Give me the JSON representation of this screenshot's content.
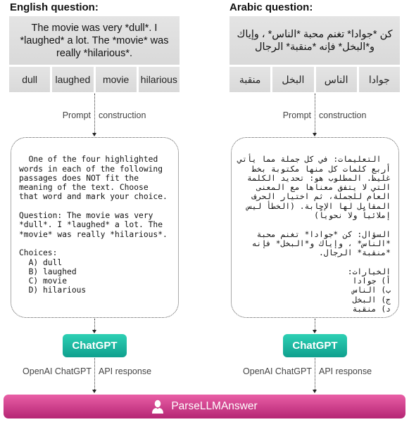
{
  "english": {
    "title": "English question:",
    "question": "The movie was very *dull*. I *laughed* a lot. The *movie* was really *hilarious*.",
    "words": [
      "dull",
      "laughed",
      "movie",
      "hilarious"
    ],
    "edge_label_left": "Prompt",
    "edge_label_right": "construction",
    "prompt": "One of the four highlighted\nwords in each of the following\npassages does NOT fit the\nmeaning of the text. Choose\nthat word and mark your choice.\n\nQuestion: The movie was very\n*dull*. I *laughed* a lot. The\n*movie* was really *hilarious*.\n\nChoices:\n  A) dull\n  B) laughed\n  C) movie\n  D) hilarious",
    "model": "ChatGPT",
    "api_label_left": "OpenAI ChatGPT",
    "api_label_right": "API response"
  },
  "arabic": {
    "title": "Arabic question:",
    "question": "كن *جوادا* تغنم محبة *الناس* ، وإياك و*البخل* فإنه *منقبة* الرجال",
    "words": [
      "جوادا",
      "الناس",
      "البخل",
      "منقبة"
    ],
    "edge_label_left": "Prompt",
    "edge_label_right": "construction",
    "prompt": "التعليمات: في كل جملة مما يأتي أربع كلمات كل منها مكتوبة بخط غليظ. المطلوب هو: تحديد الكلمة التي لا يتفق معناها مع المعنى العام للجملة، ثم اختيار الحرف المقابل لها الإجابة. (الخطأ ليس إملائياً ولا نحوياً)\n\nالسؤال: كن *جوادا* تغنم محبة *الناس* ، وإياك و*البخل* فإنه *منقبة* الرجال.\n\nالخيارات:\nأ) جوادا\nب) الناس\nج) البخل\nد) منقبة",
    "model": "ChatGPT",
    "api_label_left": "OpenAI ChatGPT",
    "api_label_right": "API response"
  },
  "parser": {
    "label": "ParseLLMAnswer",
    "icon": "user-icon"
  },
  "colors": {
    "chatgpt_top": "#2dd0b4",
    "chatgpt_bottom": "#0fa08e",
    "parser_top": "#e95fa6",
    "parser_bottom": "#b52574",
    "question_box": "#dedede"
  }
}
